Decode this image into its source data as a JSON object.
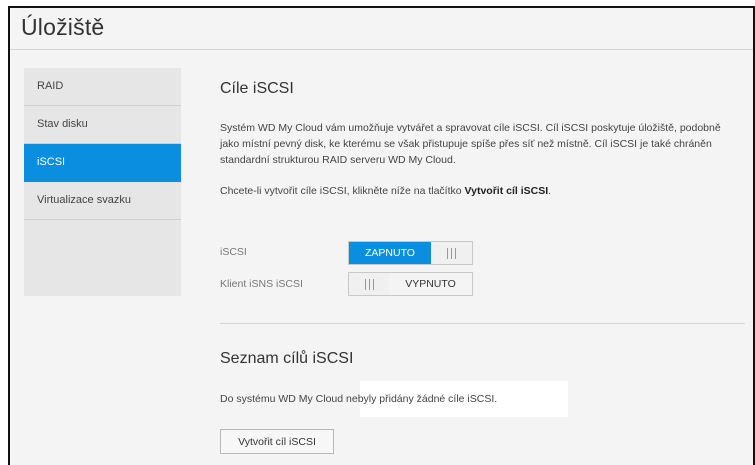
{
  "page": {
    "title": "Úložiště"
  },
  "sidebar": {
    "items": [
      {
        "label": "RAID"
      },
      {
        "label": "Stav disku"
      },
      {
        "label": "iSCSI"
      },
      {
        "label": "Virtualizace svazku"
      }
    ],
    "active_index": 2
  },
  "targets": {
    "heading": "Cíle iSCSI",
    "description": "Systém WD My Cloud vám umožňuje vytvářet a spravovat cíle iSCSI. Cíl iSCSI poskytuje úložiště, podobně jako místní pevný disk, ke kterému se však přistupuje spíše přes síť než místně. Cíl iSCSI je také chráněn standardní strukturou RAID serveru WD My Cloud.",
    "instruction_prefix": "Chcete-li vytvořit cíle iSCSI, klikněte níže na tlačítko ",
    "instruction_bold": "Vytvořit cíl iSCSI",
    "instruction_suffix": "."
  },
  "settings": {
    "iscsi": {
      "label": "iSCSI",
      "state_text": "ZAPNUTO",
      "enabled": true
    },
    "isns": {
      "label": "Klient iSNS iSCSI",
      "state_text": "VYPNUTO",
      "enabled": false
    }
  },
  "target_list": {
    "heading": "Seznam cílů iSCSI",
    "empty_message": "Do systému WD My Cloud  nebyly přidány žádné cíle iSCSI.",
    "create_button_label": "Vytvořit cíl iSCSI"
  },
  "colors": {
    "accent": "#0a8fe0",
    "background": "#f4f4f4",
    "sidebar_bg": "#e6e6e6"
  }
}
